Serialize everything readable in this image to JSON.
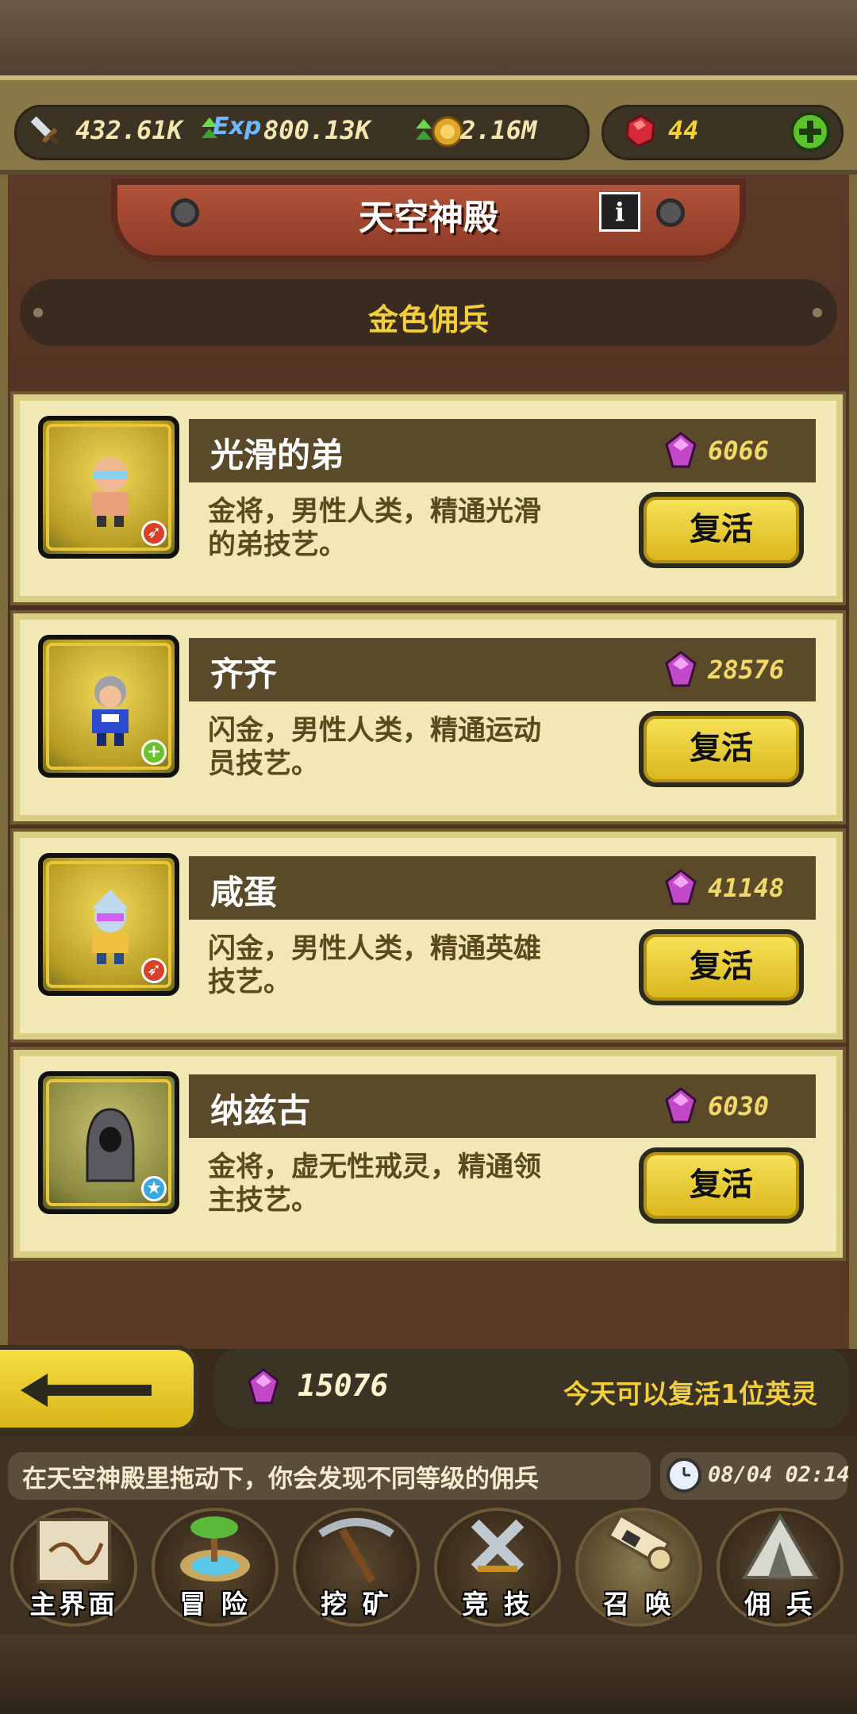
{
  "resources": {
    "attack": "432.61K",
    "exp_label": "Exp",
    "exp": "800.13K",
    "gold": "2.16M",
    "rubies": "44"
  },
  "header": {
    "title": "天空神殿",
    "info_label": "i",
    "subtitle": "金色佣兵"
  },
  "mercenaries": [
    {
      "name": "光滑的弟",
      "price": "6066",
      "desc_line1": "金将，男性人类，精通光滑",
      "desc_line2": "的弟技艺。",
      "button": "复活",
      "badge": "attack"
    },
    {
      "name": "齐齐",
      "price": "28576",
      "desc_line1": "闪金，男性人类，精通运动",
      "desc_line2": "员技艺。",
      "button": "复活",
      "badge": "heal"
    },
    {
      "name": "咸蛋",
      "price": "41148",
      "desc_line1": "闪金，男性人类，精通英雄",
      "desc_line2": "技艺。",
      "button": "复活",
      "badge": "attack"
    },
    {
      "name": "纳兹古",
      "price": "6030",
      "desc_line1": "金将，虚无性戒灵，精通领",
      "desc_line2": "主技艺。",
      "button": "复活",
      "badge": "star"
    }
  ],
  "footer": {
    "gem_count": "15076",
    "revive_info": "今天可以复活1位英灵",
    "ticker": "在天空神殿里拖动下，你会发现不同等级的佣兵",
    "datetime": "08/04 02:14"
  },
  "nav": [
    "主界面",
    "冒 险",
    "挖 矿",
    "竞 技",
    "召 唤",
    "佣 兵"
  ]
}
